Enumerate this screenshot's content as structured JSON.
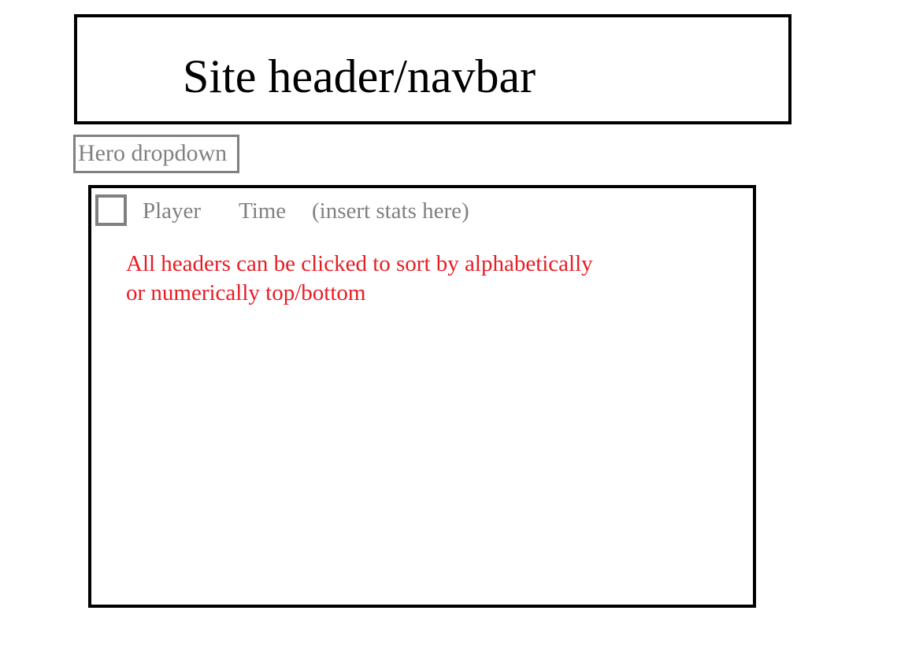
{
  "header": {
    "title": "Site header/navbar"
  },
  "hero_dropdown": {
    "label": "Hero dropdown"
  },
  "table": {
    "columns": [
      {
        "label": "Player"
      },
      {
        "label": "Time"
      },
      {
        "label": "(insert stats here)"
      }
    ],
    "note_lines": [
      "All headers can be clicked to sort by alphabetically",
      "or numerically top/bottom"
    ]
  },
  "colors": {
    "border_primary": "#000000",
    "border_secondary": "#808080",
    "placeholder_text": "#808080",
    "annotation_text": "#e81c24"
  },
  "icons": {
    "select_all": "checkbox-icon"
  }
}
